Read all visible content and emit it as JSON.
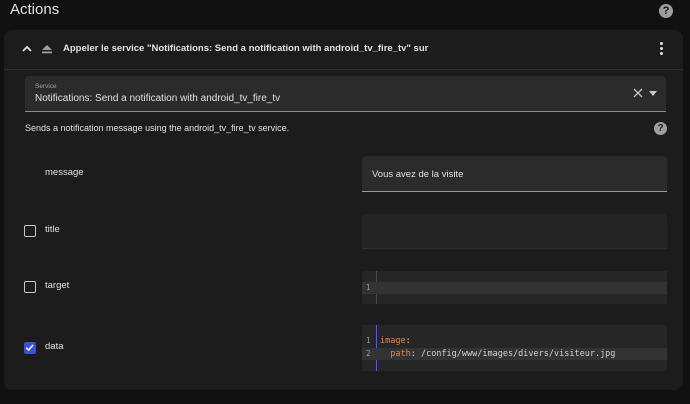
{
  "page": {
    "title": "Actions"
  },
  "action_card": {
    "header_text": "Appeler le service \"Notifications: Send a notification with android_tv_fire_tv\" sur",
    "service_field": {
      "label": "Service",
      "value": "Notifications: Send a notification with android_tv_fire_tv"
    },
    "description": "Sends a notification message using the android_tv_fire_tv service.",
    "help_glyph": "?",
    "fields": {
      "message": {
        "label": "message",
        "value": "Vous avez de la visite"
      },
      "title": {
        "label": "title",
        "checked": false,
        "value": ""
      },
      "target": {
        "label": "target",
        "checked": false,
        "lines": [
          {
            "no": "1",
            "text": ""
          }
        ]
      },
      "data": {
        "label": "data",
        "checked": true,
        "lines": [
          {
            "no": "1",
            "key": "image",
            "rest": ":"
          },
          {
            "no": "2",
            "key": "  path",
            "rest": ": /config/www/images/divers/visiteur.jpg"
          }
        ]
      }
    }
  },
  "colors": {
    "accent": "#3b4fd8",
    "yaml_key": "#e0884a",
    "background": "#111111",
    "card": "#1c1c1c"
  },
  "icons": [
    "help-icon",
    "chevron-up-icon",
    "eject-icon",
    "more-vertical-icon",
    "close-icon",
    "dropdown-arrow-icon",
    "check-icon"
  ]
}
